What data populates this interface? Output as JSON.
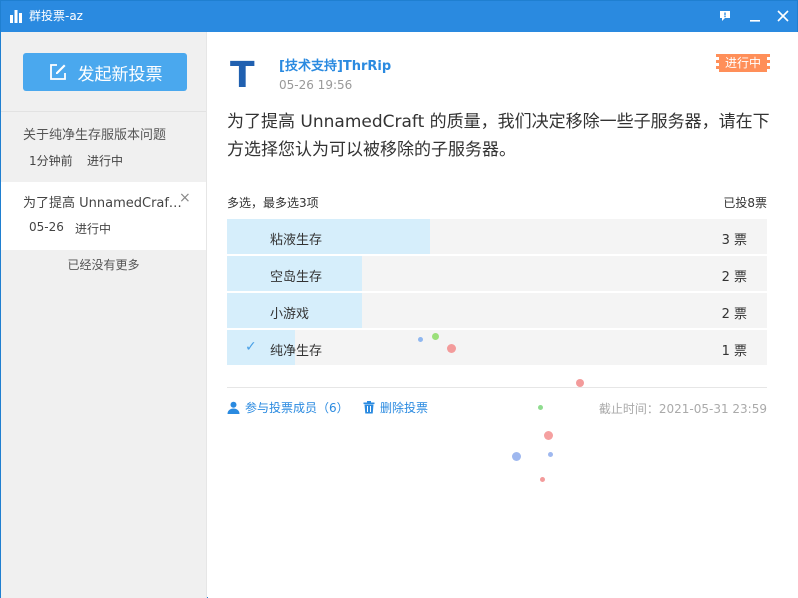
{
  "window": {
    "title": "群投票-az"
  },
  "sidebar": {
    "new_vote_label": "发起新投票",
    "items": [
      {
        "title": "关于纯净生存服版本问题",
        "time": "1分钟前",
        "status": "进行中"
      },
      {
        "title": "为了提高 UnnamedCraft...",
        "time": "05-26",
        "status": "进行中"
      }
    ],
    "no_more": "已经没有更多"
  },
  "vote": {
    "avatar_letter": "T",
    "author": "[技术支持]ThrRip",
    "post_time": "05-26 19:56",
    "status": "进行中",
    "question": "为了提高 UnnamedCraft 的质量，我们决定移除一些子服务器，请在下方选择您认为可以被移除的子服务器。",
    "mode": "多选，最多选3项",
    "total": "已投8票",
    "options": [
      {
        "label": "粘液生存",
        "count": "3 票",
        "votes": 3,
        "checked": false
      },
      {
        "label": "空岛生存",
        "count": "2 票",
        "votes": 2,
        "checked": false
      },
      {
        "label": "小游戏",
        "count": "2 票",
        "votes": 2,
        "checked": false
      },
      {
        "label": "纯净生存",
        "count": "1 票",
        "votes": 1,
        "checked": true
      }
    ],
    "members_label": "参与投票成员（6）",
    "delete_label": "删除投票",
    "deadline": "截止时间：2021-05-31 23:59"
  },
  "colors": {
    "accent": "#2a8ae0",
    "button": "#4aa8ee",
    "bar": "#d6eefb",
    "badge": "#ff8f59"
  }
}
